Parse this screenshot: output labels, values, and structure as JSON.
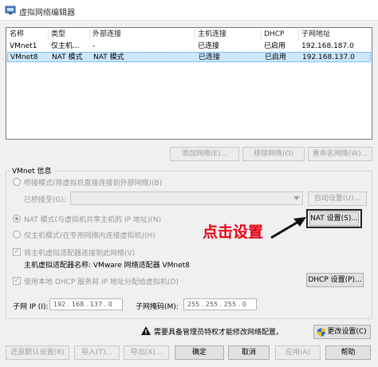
{
  "window": {
    "title": "虚拟网络编辑器"
  },
  "table": {
    "headers": [
      "名称",
      "类型",
      "外部连接",
      "主机连接",
      "DHCP",
      "子网地址"
    ],
    "rows": [
      [
        "VMnet1",
        "仅主机...",
        "-",
        "已连接",
        "已启用",
        "192.168.187.0"
      ],
      [
        "VMnet8",
        "NAT 模式",
        "NAT 模式",
        "已连接",
        "已启用",
        "192.168.137.0"
      ]
    ]
  },
  "network_buttons": {
    "add": "添加网络(E)...",
    "remove": "移除网络(O)",
    "rename": "重命名网络(W)..."
  },
  "vmnet_info": {
    "group_title": "VMnet 信息",
    "bridged_label": "桥接模式(将虚拟机直接连接到外部网络)(B)",
    "bridged_to_label": "已桥接至(G):",
    "auto_settings": "自动设置(U)...",
    "nat_label": "NAT 模式(与虚拟机共享主机的 IP 地址)(N)",
    "nat_settings": "NAT 设置(S)...",
    "hostonly_label": "仅主机模式(在专用网络内连接虚拟机)(H)",
    "connect_adapter_label": "将主机虚拟适配器连接到此网络(V)",
    "adapter_name_label": "主机虚拟适配器名称: VMware 网络适配器 VMnet8",
    "dhcp_label": "使用本地 DHCP 服务将 IP 地址分配给虚拟机(D)",
    "dhcp_settings": "DHCP 设置(P)...",
    "subnet_ip_label": "子网 IP (I):",
    "subnet_ip_value": "192 . 168 . 137 .  0",
    "subnet_mask_label": "子网掩码(M):",
    "subnet_mask_value": "255 . 255 . 255 .  0"
  },
  "annotation": {
    "text": "点击设置",
    "color": "#e60012"
  },
  "admin": {
    "notice": "需要具备管理员特权才能修改网络配置。",
    "change_settings": "更改设置(C)"
  },
  "footer": {
    "restore": "还原默认设置(R)",
    "import": "导入(T)...",
    "export": "导出(X)...",
    "ok": "确定",
    "cancel": "取消",
    "apply": "应用(A)",
    "help": "帮助"
  }
}
